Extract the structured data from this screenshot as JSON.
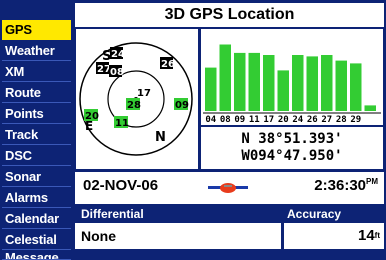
{
  "sidebar": {
    "items": [
      {
        "label": "GPS",
        "active": true
      },
      {
        "label": "Weather"
      },
      {
        "label": "XM"
      },
      {
        "label": "Route"
      },
      {
        "label": "Points"
      },
      {
        "label": "Track"
      },
      {
        "label": "DSC"
      },
      {
        "label": "Sonar"
      },
      {
        "label": "Alarms"
      },
      {
        "label": "Calendar"
      },
      {
        "label": "Celestial"
      },
      {
        "label": "Message"
      }
    ]
  },
  "header": {
    "title": "3D GPS Location"
  },
  "sky": {
    "north_label": "N",
    "east_label": "E",
    "satellites": [
      {
        "prn": "24",
        "color": "#ffffff"
      },
      {
        "prn": "27",
        "color": "#ffffff"
      },
      {
        "prn": "08",
        "color": "#ffffff"
      },
      {
        "prn": "26",
        "color": "#ffffff"
      },
      {
        "prn": "17",
        "color": "#000000"
      },
      {
        "prn": "28",
        "color": "#000000"
      },
      {
        "prn": "09",
        "color": "#000000"
      },
      {
        "prn": "11",
        "color": "#000000"
      },
      {
        "prn": "20",
        "color": "#000000"
      },
      {
        "prn": "S",
        "color": "#000000"
      }
    ]
  },
  "signal_bars": {
    "prns": [
      "04",
      "08",
      "09",
      "11",
      "17",
      "20",
      "24",
      "26",
      "27",
      "28",
      "29",
      ""
    ],
    "strength": [
      0.62,
      0.95,
      0.83,
      0.83,
      0.8,
      0.58,
      0.8,
      0.78,
      0.8,
      0.72,
      0.68,
      0.08
    ],
    "bar_color": "#33cc33"
  },
  "position": {
    "lat": "N  38°51.393'",
    "lon": "W094°47.950'"
  },
  "status": {
    "date": "02-NOV-06",
    "time": "2:36:30",
    "time_suffix": "PM"
  },
  "differential": {
    "label": "Differential",
    "value": "None"
  },
  "accuracy": {
    "label": "Accuracy",
    "value": "14",
    "unit": "ft"
  }
}
